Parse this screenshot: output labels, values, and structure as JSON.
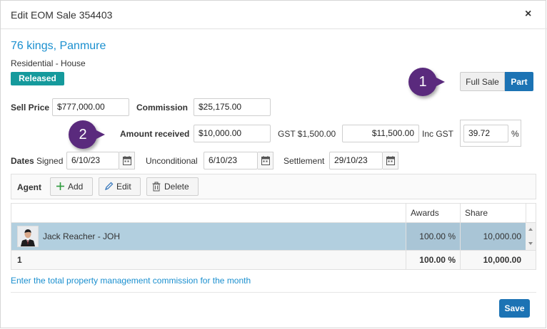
{
  "dialog": {
    "title": "Edit EOM Sale 354403",
    "close_glyph": "×"
  },
  "property": {
    "address": "76 kings, Panmure",
    "type": "Residential - House",
    "status_badge": "Released"
  },
  "sale_toggle": {
    "full_label": "Full Sale",
    "part_label": "Part",
    "selected": "Part"
  },
  "callouts": {
    "one": "1",
    "two": "2"
  },
  "price": {
    "sell_price_label": "Sell Price",
    "sell_price_value": "$777,000.00",
    "commission_label": "Commission",
    "commission_value": "$25,175.00"
  },
  "amount": {
    "label": "Amount received",
    "value": "$10,000.00",
    "gst_label": "GST $1,500.00",
    "inc_gst_value": "$11,500.00",
    "inc_gst_label": "Inc GST",
    "percent_value": "39.72",
    "percent_sign": "%"
  },
  "dates": {
    "dates_label": "Dates",
    "signed_label": "Signed",
    "signed_value": "6/10/23",
    "unconditional_label": "Unconditional",
    "unconditional_value": "6/10/23",
    "settlement_label": "Settlement",
    "settlement_value": "29/10/23"
  },
  "agent_toolbar": {
    "label": "Agent",
    "add_label": "Add",
    "edit_label": "Edit",
    "delete_label": "Delete"
  },
  "agent_grid": {
    "columns": [
      "",
      "Awards",
      "Share"
    ],
    "rows": [
      {
        "name": "Jack Reacher - JOH",
        "awards": "100.00 %",
        "share": "10,000.00"
      }
    ],
    "footer": {
      "count": "1",
      "awards": "100.00 %",
      "share": "10,000.00"
    }
  },
  "hint": "Enter the total property management commission for the month",
  "save_label": "Save",
  "colors": {
    "accent": "#1c73b4",
    "link": "#1a8fcf",
    "badge": "#159a9c",
    "callout": "#5a2a7d",
    "selected_row": "#b2cfdf"
  }
}
